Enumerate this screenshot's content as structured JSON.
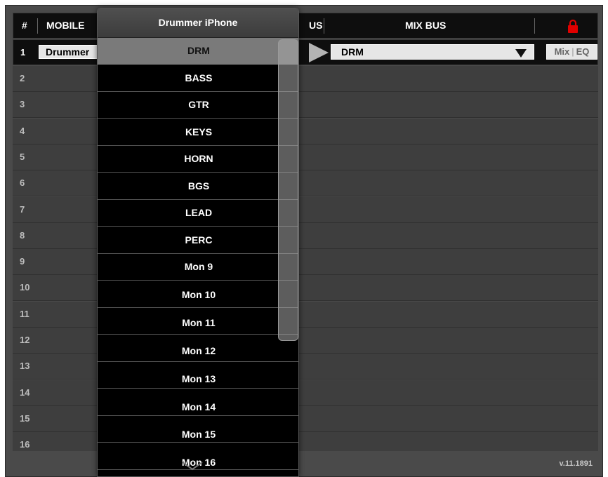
{
  "header": {
    "num_label": "#",
    "mobile_label": "MOBILE",
    "bus_label_partial": "US",
    "mixbus_label": "MIX BUS",
    "lock_color": "#e10000"
  },
  "rows": [
    {
      "num": "1",
      "name": "Drummer",
      "bus": "DRM",
      "mix": "Mix",
      "sep": "|",
      "eq": "EQ"
    },
    {
      "num": "2"
    },
    {
      "num": "3"
    },
    {
      "num": "4"
    },
    {
      "num": "5"
    },
    {
      "num": "6"
    },
    {
      "num": "7"
    },
    {
      "num": "8"
    },
    {
      "num": "9"
    },
    {
      "num": "10"
    },
    {
      "num": "11"
    },
    {
      "num": "12"
    },
    {
      "num": "13"
    },
    {
      "num": "14"
    },
    {
      "num": "15"
    },
    {
      "num": "16"
    }
  ],
  "dropdown": {
    "title": "Drummer iPhone",
    "selected": "DRM",
    "items": [
      "DRM",
      "BASS",
      "GTR",
      "KEYS",
      "HORN",
      "BGS",
      "LEAD",
      "PERC",
      "Mon 9",
      "Mon 10",
      "Mon 11",
      "Mon 12",
      "Mon 13",
      "Mon 14",
      "Mon 15",
      "Mon 16"
    ]
  },
  "footer": {
    "version": "v.11.1891"
  },
  "icons": {
    "lock": "lock-icon",
    "more": "chevron-down-icon",
    "caret": "triangle-down-icon",
    "arrow": "arrow-right-icon"
  }
}
